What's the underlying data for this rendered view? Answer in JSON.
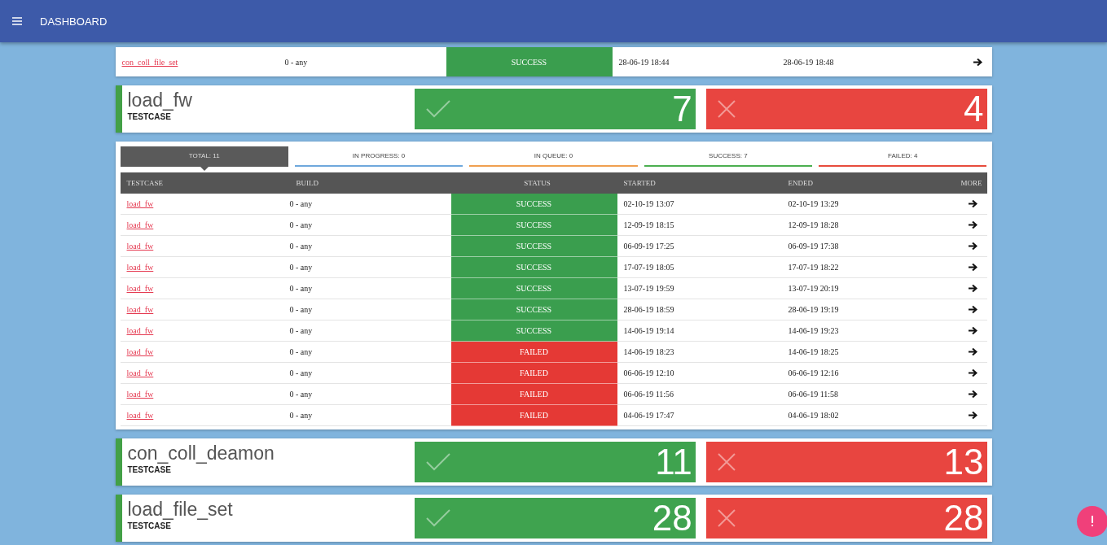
{
  "header": {
    "title": "DASHBOARD"
  },
  "top_row": {
    "testcase": "con_coll_file_set",
    "build": "0 - any",
    "status": "SUCCESS",
    "kind": "success",
    "started": "28-06-19 18:44",
    "ended": "28-06-19 18:48"
  },
  "cards_before": [
    {
      "name": "load_fw",
      "type": "TESTCASE",
      "passed": "7",
      "failed": "4"
    }
  ],
  "panel": {
    "tabs": [
      {
        "label": "TOTAL: 11",
        "selected": true,
        "color": "#5a5a5a"
      },
      {
        "label": "IN PROGRESS: 0",
        "selected": false,
        "color": "#6fa8dc"
      },
      {
        "label": "IN QUEUE: 0",
        "selected": false,
        "color": "#f0a050"
      },
      {
        "label": "SUCCESS: 7",
        "selected": false,
        "color": "#4caf50"
      },
      {
        "label": "FAILED: 4",
        "selected": false,
        "color": "#e74c3c"
      }
    ],
    "columns": [
      "TESTCASE",
      "BUILD",
      "STATUS",
      "STARTED",
      "ENDED",
      "MORE"
    ],
    "rows": [
      {
        "testcase": "load_fw",
        "build": "0 - any",
        "status": "SUCCESS",
        "kind": "success",
        "started": "02-10-19 13:07",
        "ended": "02-10-19 13:29"
      },
      {
        "testcase": "load_fw",
        "build": "0 - any",
        "status": "SUCCESS",
        "kind": "success",
        "started": "12-09-19 18:15",
        "ended": "12-09-19 18:28"
      },
      {
        "testcase": "load_fw",
        "build": "0 - any",
        "status": "SUCCESS",
        "kind": "success",
        "started": "06-09-19 17:25",
        "ended": "06-09-19 17:38"
      },
      {
        "testcase": "load_fw",
        "build": "0 - any",
        "status": "SUCCESS",
        "kind": "success",
        "started": "17-07-19 18:05",
        "ended": "17-07-19 18:22"
      },
      {
        "testcase": "load_fw",
        "build": "0 - any",
        "status": "SUCCESS",
        "kind": "success",
        "started": "13-07-19 19:59",
        "ended": "13-07-19 20:19"
      },
      {
        "testcase": "load_fw",
        "build": "0 - any",
        "status": "SUCCESS",
        "kind": "success",
        "started": "28-06-19 18:59",
        "ended": "28-06-19 19:19"
      },
      {
        "testcase": "load_fw",
        "build": "0 - any",
        "status": "SUCCESS",
        "kind": "success",
        "started": "14-06-19 19:14",
        "ended": "14-06-19 19:23"
      },
      {
        "testcase": "load_fw",
        "build": "0 - any",
        "status": "FAILED",
        "kind": "failed",
        "started": "14-06-19 18:23",
        "ended": "14-06-19 18:25"
      },
      {
        "testcase": "load_fw",
        "build": "0 - any",
        "status": "FAILED",
        "kind": "failed",
        "started": "06-06-19 12:10",
        "ended": "06-06-19 12:16"
      },
      {
        "testcase": "load_fw",
        "build": "0 - any",
        "status": "FAILED",
        "kind": "failed",
        "started": "06-06-19 11:56",
        "ended": "06-06-19 11:58"
      },
      {
        "testcase": "load_fw",
        "build": "0 - any",
        "status": "FAILED",
        "kind": "failed",
        "started": "04-06-19 17:47",
        "ended": "04-06-19 18:02"
      }
    ]
  },
  "cards_after": [
    {
      "name": "con_coll_deamon",
      "type": "TESTCASE",
      "passed": "11",
      "failed": "13"
    },
    {
      "name": "load_file_set",
      "type": "TESTCASE",
      "passed": "28",
      "failed": "28"
    }
  ]
}
